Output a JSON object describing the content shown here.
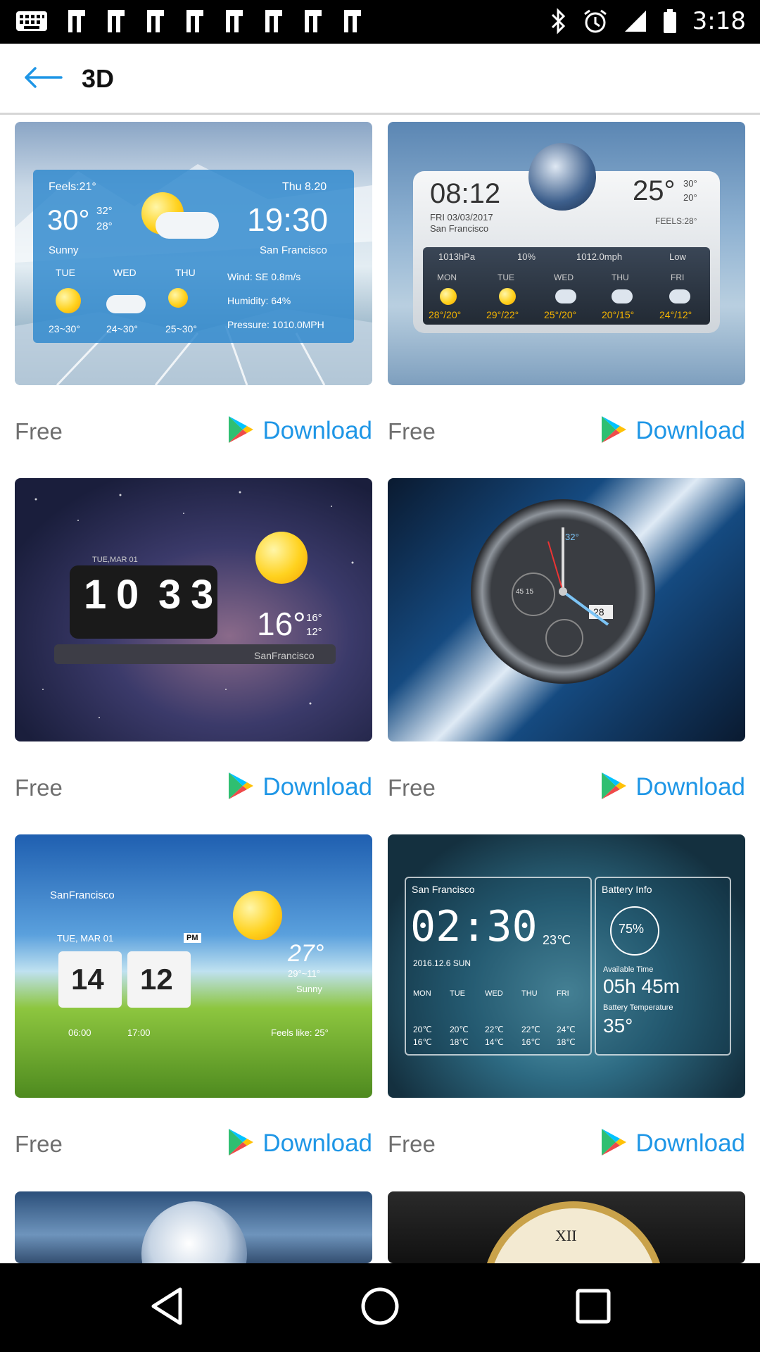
{
  "status_bar": {
    "time": "3:18"
  },
  "header": {
    "title": "3D"
  },
  "cards": [
    {
      "price": "Free",
      "action": "Download",
      "preview": {
        "feels": "Feels:21°",
        "date": "Thu 8.20",
        "temp": "30°",
        "hi": "32°",
        "lo": "28°",
        "time": "19:30",
        "cond": "Sunny",
        "city": "San Francisco",
        "days": [
          "TUE",
          "WED",
          "THU"
        ],
        "ranges": [
          "23~30°",
          "24~30°",
          "25~30°"
        ],
        "wind": "Wind:   SE 0.8m/s",
        "humidity": "Humidity:   64%",
        "pressure": "Pressure: 1010.0MPH"
      }
    },
    {
      "price": "Free",
      "action": "Download",
      "preview": {
        "time": "08:12",
        "temp": "25°",
        "hi": "30°",
        "lo": "20°",
        "date": "FRI 03/03/2017",
        "city": "San Francisco",
        "feels": "FEELS:28°",
        "stats": [
          "1013hPa",
          "10%",
          "1012.0mph",
          "Low"
        ],
        "days": [
          "MON",
          "TUE",
          "WED",
          "THU",
          "FRI"
        ],
        "ranges": [
          "28°/20°",
          "29°/22°",
          "25°/20°",
          "20°/15°",
          "24°/12°"
        ]
      }
    },
    {
      "price": "Free",
      "action": "Download",
      "preview": {
        "date": "TUE,MAR 01",
        "digits": [
          "1",
          "0",
          "3",
          "3"
        ],
        "temp": "16°",
        "hi": "16°",
        "lo": "12°",
        "city": "SanFrancisco"
      }
    },
    {
      "price": "Free",
      "action": "Download",
      "preview": {
        "top": "32°",
        "date_box": "28",
        "sub_left": "45  15"
      }
    },
    {
      "price": "Free",
      "action": "Download",
      "preview": {
        "city": "SanFrancisco",
        "date": "TUE, MAR  01",
        "ampm": "PM",
        "hour": "14",
        "min": "12",
        "temp": "27°",
        "range": "29°~11°",
        "cond": "Sunny",
        "sunrise": "06:00",
        "sunset": "17:00",
        "feels": "Feels like: 25°"
      }
    },
    {
      "price": "Free",
      "action": "Download",
      "preview": {
        "city": "San Francisco",
        "battery_title": "Battery Info",
        "time": "02:30",
        "temp": "23℃",
        "date": "2016.12.6 SUN",
        "battery_pct": "75%",
        "avail": "Available Time",
        "avail_val": "05h 45m",
        "bt_label": "Battery Temperature",
        "bt_val": "35°",
        "days": [
          "MON",
          "TUE",
          "WED",
          "THU",
          "FRI"
        ],
        "hi": [
          "20℃",
          "20℃",
          "22℃",
          "22℃",
          "24℃"
        ],
        "lo": [
          "16℃",
          "18℃",
          "14℃",
          "16℃",
          "18℃"
        ]
      }
    },
    {
      "price": "",
      "action": ""
    },
    {
      "price": "",
      "action": "",
      "preview": {
        "numeral": "XII"
      }
    }
  ],
  "colors": {
    "accent": "#1e96e6",
    "muted": "#6f6f6f"
  }
}
